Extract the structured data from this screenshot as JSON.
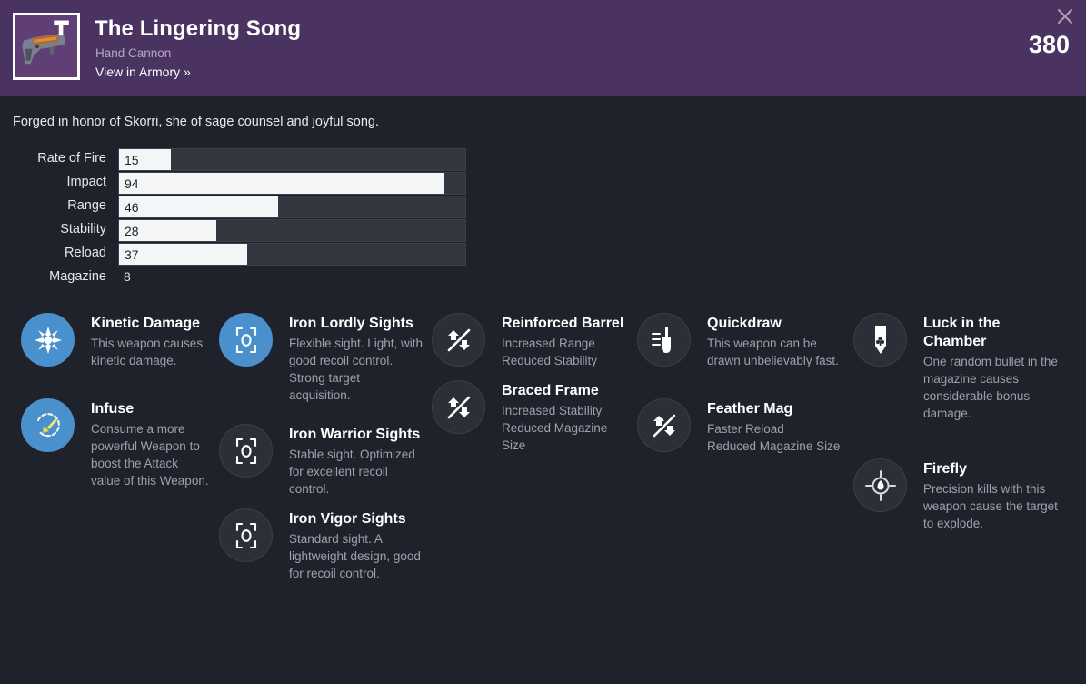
{
  "header": {
    "title": "The Lingering Song",
    "subtitle": "Hand Cannon",
    "armory_link": "View in Armory »",
    "attack_value": "380",
    "close_icon": "close-icon",
    "item_icon": "hand-cannon-icon",
    "background_color": "#4a3361"
  },
  "flavor_text": "Forged in honor of Skorri, she of sage counsel and joyful song.",
  "stats": [
    {
      "label": "Rate of Fire",
      "value": "15",
      "pct": 15,
      "has_bar": true
    },
    {
      "label": "Impact",
      "value": "94",
      "pct": 94,
      "has_bar": true
    },
    {
      "label": "Range",
      "value": "46",
      "pct": 46,
      "has_bar": true
    },
    {
      "label": "Stability",
      "value": "28",
      "pct": 28,
      "has_bar": true
    },
    {
      "label": "Reload",
      "value": "37",
      "pct": 37,
      "has_bar": true
    },
    {
      "label": "Magazine",
      "value": "8",
      "pct": 0,
      "has_bar": false
    }
  ],
  "colors": {
    "accent_blue": "#4a90cc",
    "body_bg": "#1f222a",
    "bar_track": "#32363f",
    "bar_fill": "#f4f5f6",
    "header_purple": "#4a3361"
  },
  "perk_columns": [
    {
      "perks": [
        {
          "name": "Kinetic Damage",
          "desc": "This weapon causes kinetic damage.",
          "icon": "kinetic-damage-icon",
          "active": true
        },
        {
          "name": "Infuse",
          "desc": "Consume a more powerful Weapon to boost the Attack value of this Weapon.",
          "icon": "infuse-icon",
          "active": true
        }
      ]
    },
    {
      "perks": [
        {
          "name": "Iron Lordly Sights",
          "desc": "Flexible sight. Light, with good recoil control. Strong target acquisition.",
          "icon": "sight-icon",
          "active": true
        },
        {
          "name": "Iron Warrior Sights",
          "desc": "Stable sight. Optimized for excellent recoil control.",
          "icon": "sight-icon",
          "active": false
        },
        {
          "name": "Iron Vigor Sights",
          "desc": "Standard sight. A lightweight design, good for recoil control.",
          "icon": "sight-icon",
          "active": false
        }
      ]
    },
    {
      "perks": [
        {
          "name": "Reinforced Barrel",
          "desc": "Increased Range\nReduced Stability",
          "icon": "tradeoff-icon",
          "active": false
        },
        {
          "name": "Braced Frame",
          "desc": "Increased Stability\nReduced Magazine Size",
          "icon": "tradeoff-icon",
          "active": false
        }
      ]
    },
    {
      "perks": [
        {
          "name": "Quickdraw",
          "desc": "This weapon can be drawn unbelievably fast.",
          "icon": "quickdraw-icon",
          "active": false
        },
        {
          "name": "Feather Mag",
          "desc": "Faster Reload\nReduced Magazine Size",
          "icon": "tradeoff-icon",
          "active": false
        }
      ]
    },
    {
      "perks": [
        {
          "name": "Luck in the Chamber",
          "desc": "One random bullet in the magazine causes considerable bonus damage.",
          "icon": "luck-bullet-icon",
          "active": false
        },
        {
          "name": "Firefly",
          "desc": "Precision kills with this weapon cause the target to explode.",
          "icon": "firefly-icon",
          "active": false
        }
      ]
    }
  ]
}
